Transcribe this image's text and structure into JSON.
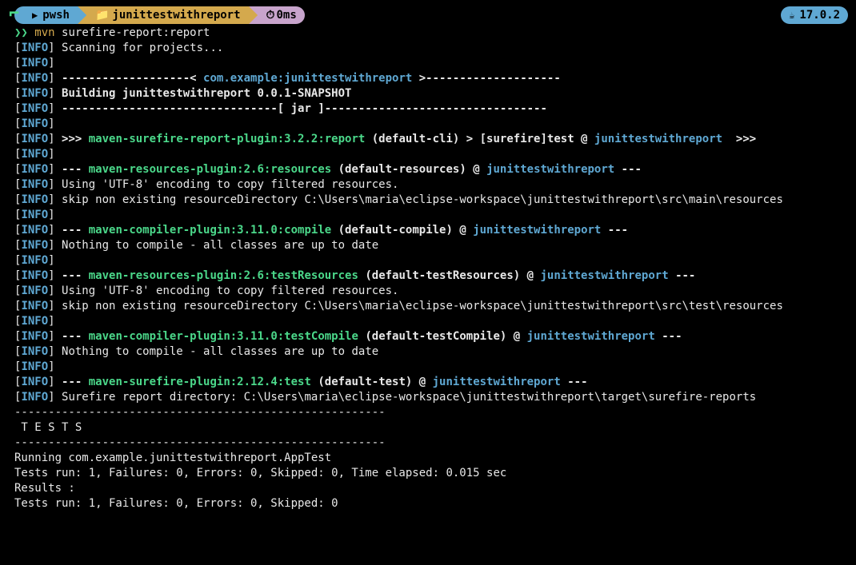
{
  "prompt": {
    "shell": "pwsh",
    "folder_icon": "📁",
    "folder": "junittestwithreport",
    "timer_icon": "⏱",
    "timer": "0ms",
    "java_icon": "☕",
    "java_version": "17.0.2",
    "caret": "❯❯",
    "command": "mvn",
    "args": "surefire-report:report"
  },
  "lines": [
    {
      "t": "info",
      "s": [
        {
          "c": "txt",
          "v": " Scanning for projects..."
        }
      ]
    },
    {
      "t": "info",
      "s": [
        {
          "c": "txt",
          "v": ""
        }
      ]
    },
    {
      "t": "info",
      "s": [
        {
          "c": "bold",
          "v": " -------------------< "
        },
        {
          "c": "cyan",
          "v": "com.example:junittestwithreport"
        },
        {
          "c": "bold",
          "v": " >--------------------"
        }
      ]
    },
    {
      "t": "info",
      "s": [
        {
          "c": "bold",
          "v": " Building junittestwithreport 0.0.1-SNAPSHOT"
        }
      ]
    },
    {
      "t": "info",
      "s": [
        {
          "c": "bold",
          "v": " --------------------------------[ jar ]---------------------------------"
        }
      ]
    },
    {
      "t": "info",
      "s": [
        {
          "c": "txt",
          "v": ""
        }
      ]
    },
    {
      "t": "info",
      "s": [
        {
          "c": "bold",
          "v": " >>> "
        },
        {
          "c": "green",
          "v": "maven-surefire-report-plugin:3.2.2:report"
        },
        {
          "c": "bold",
          "v": " (default-cli) > [surefire]test @ "
        },
        {
          "c": "cyan",
          "v": "junittestwithreport"
        },
        {
          "c": "bold",
          "v": "  >>>"
        }
      ]
    },
    {
      "t": "info",
      "s": [
        {
          "c": "txt",
          "v": ""
        }
      ]
    },
    {
      "t": "info",
      "s": [
        {
          "c": "bold",
          "v": " --- "
        },
        {
          "c": "green",
          "v": "maven-resources-plugin:2.6:resources"
        },
        {
          "c": "bold",
          "v": " (default-resources) @ "
        },
        {
          "c": "cyan",
          "v": "junittestwithreport"
        },
        {
          "c": "bold",
          "v": " ---"
        }
      ]
    },
    {
      "t": "info",
      "s": [
        {
          "c": "txt",
          "v": " Using 'UTF-8' encoding to copy filtered resources."
        }
      ]
    },
    {
      "t": "info",
      "s": [
        {
          "c": "txt",
          "v": " skip non existing resourceDirectory C:\\Users\\maria\\eclipse-workspace\\junittestwithreport\\src\\main\\resources"
        }
      ]
    },
    {
      "t": "info",
      "s": [
        {
          "c": "txt",
          "v": ""
        }
      ]
    },
    {
      "t": "info",
      "s": [
        {
          "c": "bold",
          "v": " --- "
        },
        {
          "c": "green",
          "v": "maven-compiler-plugin:3.11.0:compile"
        },
        {
          "c": "bold",
          "v": " (default-compile) @ "
        },
        {
          "c": "cyan",
          "v": "junittestwithreport"
        },
        {
          "c": "bold",
          "v": " ---"
        }
      ]
    },
    {
      "t": "info",
      "s": [
        {
          "c": "txt",
          "v": " Nothing to compile - all classes are up to date"
        }
      ]
    },
    {
      "t": "info",
      "s": [
        {
          "c": "txt",
          "v": ""
        }
      ]
    },
    {
      "t": "info",
      "s": [
        {
          "c": "bold",
          "v": " --- "
        },
        {
          "c": "green",
          "v": "maven-resources-plugin:2.6:testResources"
        },
        {
          "c": "bold",
          "v": " (default-testResources) @ "
        },
        {
          "c": "cyan",
          "v": "junittestwithreport"
        },
        {
          "c": "bold",
          "v": " ---"
        }
      ]
    },
    {
      "t": "info",
      "s": [
        {
          "c": "txt",
          "v": " Using 'UTF-8' encoding to copy filtered resources."
        }
      ]
    },
    {
      "t": "info",
      "s": [
        {
          "c": "txt",
          "v": " skip non existing resourceDirectory C:\\Users\\maria\\eclipse-workspace\\junittestwithreport\\src\\test\\resources"
        }
      ]
    },
    {
      "t": "info",
      "s": [
        {
          "c": "txt",
          "v": ""
        }
      ]
    },
    {
      "t": "info",
      "s": [
        {
          "c": "bold",
          "v": " --- "
        },
        {
          "c": "green",
          "v": "maven-compiler-plugin:3.11.0:testCompile"
        },
        {
          "c": "bold",
          "v": " (default-testCompile) @ "
        },
        {
          "c": "cyan",
          "v": "junittestwithreport"
        },
        {
          "c": "bold",
          "v": " ---"
        }
      ]
    },
    {
      "t": "info",
      "s": [
        {
          "c": "txt",
          "v": " Nothing to compile - all classes are up to date"
        }
      ]
    },
    {
      "t": "info",
      "s": [
        {
          "c": "txt",
          "v": ""
        }
      ]
    },
    {
      "t": "info",
      "s": [
        {
          "c": "bold",
          "v": " --- "
        },
        {
          "c": "green",
          "v": "maven-surefire-plugin:2.12.4:test"
        },
        {
          "c": "bold",
          "v": " (default-test) @ "
        },
        {
          "c": "cyan",
          "v": "junittestwithreport"
        },
        {
          "c": "bold",
          "v": " ---"
        }
      ]
    },
    {
      "t": "info",
      "s": [
        {
          "c": "txt",
          "v": " Surefire report directory: C:\\Users\\maria\\eclipse-workspace\\junittestwithreport\\target\\surefire-reports"
        }
      ]
    },
    {
      "t": "plain",
      "s": [
        {
          "c": "txt",
          "v": ""
        }
      ]
    },
    {
      "t": "plain",
      "s": [
        {
          "c": "txt",
          "v": "-------------------------------------------------------"
        }
      ]
    },
    {
      "t": "plain",
      "s": [
        {
          "c": "txt",
          "v": " T E S T S"
        }
      ]
    },
    {
      "t": "plain",
      "s": [
        {
          "c": "txt",
          "v": "-------------------------------------------------------"
        }
      ]
    },
    {
      "t": "plain",
      "s": [
        {
          "c": "txt",
          "v": "Running com.example.junittestwithreport.AppTest"
        }
      ]
    },
    {
      "t": "plain",
      "s": [
        {
          "c": "txt",
          "v": "Tests run: 1, Failures: 0, Errors: 0, Skipped: 0, Time elapsed: 0.015 sec"
        }
      ]
    },
    {
      "t": "plain",
      "s": [
        {
          "c": "txt",
          "v": ""
        }
      ]
    },
    {
      "t": "plain",
      "s": [
        {
          "c": "txt",
          "v": "Results :"
        }
      ]
    },
    {
      "t": "plain",
      "s": [
        {
          "c": "txt",
          "v": ""
        }
      ]
    },
    {
      "t": "plain",
      "s": [
        {
          "c": "txt",
          "v": "Tests run: 1, Failures: 0, Errors: 0, Skipped: 0"
        }
      ]
    }
  ]
}
